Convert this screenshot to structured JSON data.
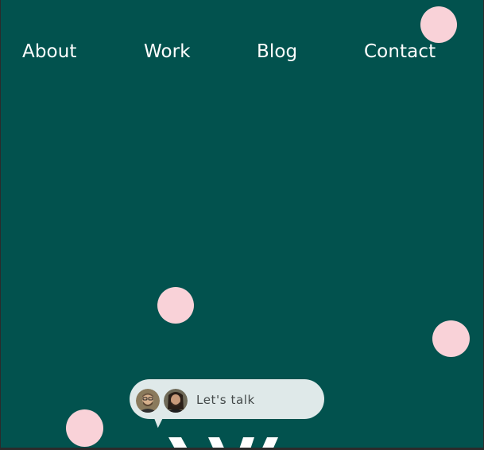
{
  "nav": {
    "items": [
      {
        "label": "About"
      },
      {
        "label": "Work"
      },
      {
        "label": "Blog"
      },
      {
        "label": "Contact"
      }
    ]
  },
  "cta": {
    "label": "Let's talk",
    "avatars": [
      "avatar-bearded-man-glasses",
      "avatar-long-hair-man"
    ]
  },
  "colors": {
    "background": "#02524e",
    "dot": "#f9d2d8",
    "cta_background": "#dfe9e9",
    "nav_text": "#ffffff"
  }
}
